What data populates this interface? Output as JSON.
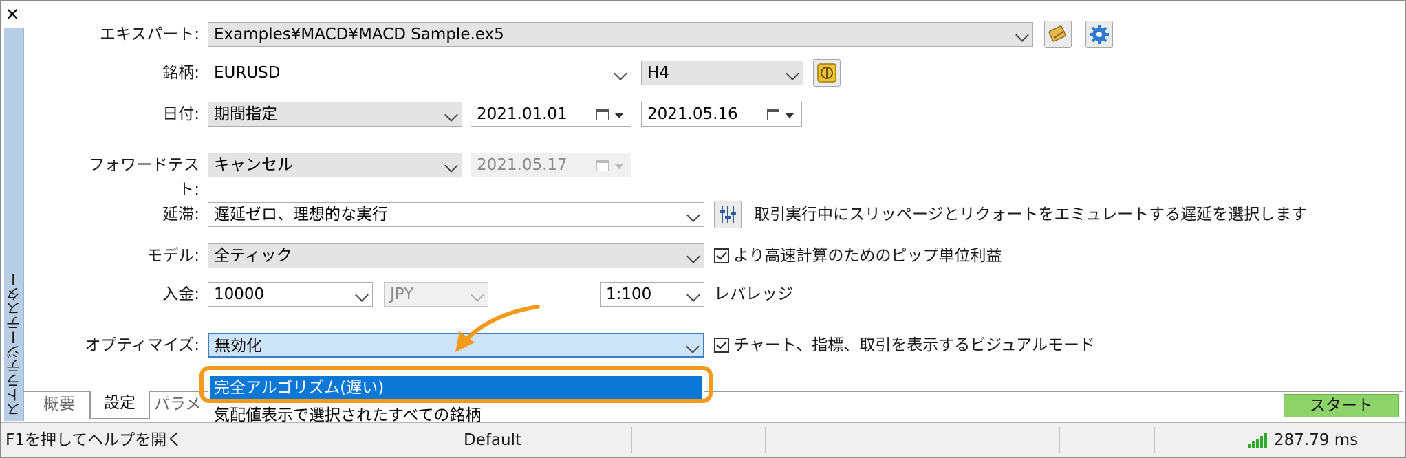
{
  "window": {
    "close_icon": "close-icon",
    "sidebar_title": "ストラテジーテスター"
  },
  "form": {
    "expert": {
      "label": "エキスパート:",
      "value": "Examples¥MACD¥MACD Sample.ex5"
    },
    "symbol": {
      "label": "銘柄:",
      "value": "EURUSD",
      "timeframe": "H4"
    },
    "date": {
      "label": "日付:",
      "mode": "期間指定",
      "from": "2021.01.01",
      "to": "2021.05.16"
    },
    "forward": {
      "label": "フォワードテスト:",
      "mode": "キャンセル",
      "date": "2021.05.17"
    },
    "delay": {
      "label": "延滞:",
      "value": "遅延ゼロ、理想的な実行",
      "description": "取引実行中にスリッページとリクォートをエミュレートする遅延を選択します"
    },
    "model": {
      "label": "モデル:",
      "value": "全ティック",
      "checkbox_label": "より高速計算のためのピップ単位利益",
      "checked": true
    },
    "deposit": {
      "label": "入金:",
      "amount": "10000",
      "currency": "JPY",
      "leverage": "1:100",
      "leverage_label": "レバレッジ"
    },
    "optimization": {
      "label": "オプティマイズ:",
      "value": "無効化",
      "visual_label": "チャート、指標、取引を表示するビジュアルモード",
      "visual_checked": true,
      "options": [
        "完全アルゴリズム(遅い)",
        "気配値表示で選択されたすべての銘柄"
      ],
      "selected_option": "完全アルゴリズム(遅い)"
    }
  },
  "tabs": [
    {
      "label": "概要",
      "active": false
    },
    {
      "label": "設定",
      "active": true
    },
    {
      "label": "パラメ",
      "active": false
    }
  ],
  "start_button": {
    "label": "スタート"
  },
  "statusbar": {
    "help": "F1を押してヘルプを開く",
    "profile": "Default",
    "ping": "287.79 ms"
  },
  "colors": {
    "accent_highlight": "#f39a1d",
    "selection_blue": "#0b78d7",
    "start_green": "#8ed26a",
    "sidebar": "#b8cde6"
  }
}
